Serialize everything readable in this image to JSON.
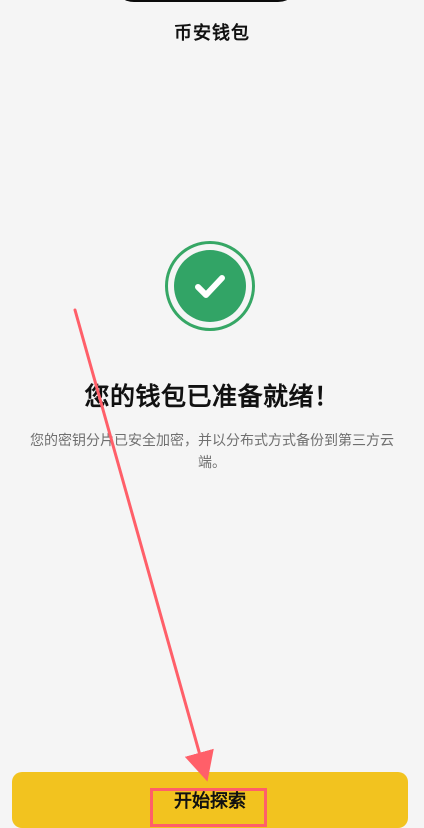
{
  "header": {
    "title": "币安钱包"
  },
  "success": {
    "headline": "您的钱包已准备就绪！",
    "description": "您的密钥分片已安全加密，并以分布式方式备份到第三方云端。"
  },
  "actions": {
    "start_label": "开始探索"
  },
  "colors": {
    "accent_yellow": "#f2c31f",
    "success_green": "#32a466",
    "annotation_red": "#ff5f69"
  },
  "icons": {
    "success": "check-circle-icon"
  }
}
